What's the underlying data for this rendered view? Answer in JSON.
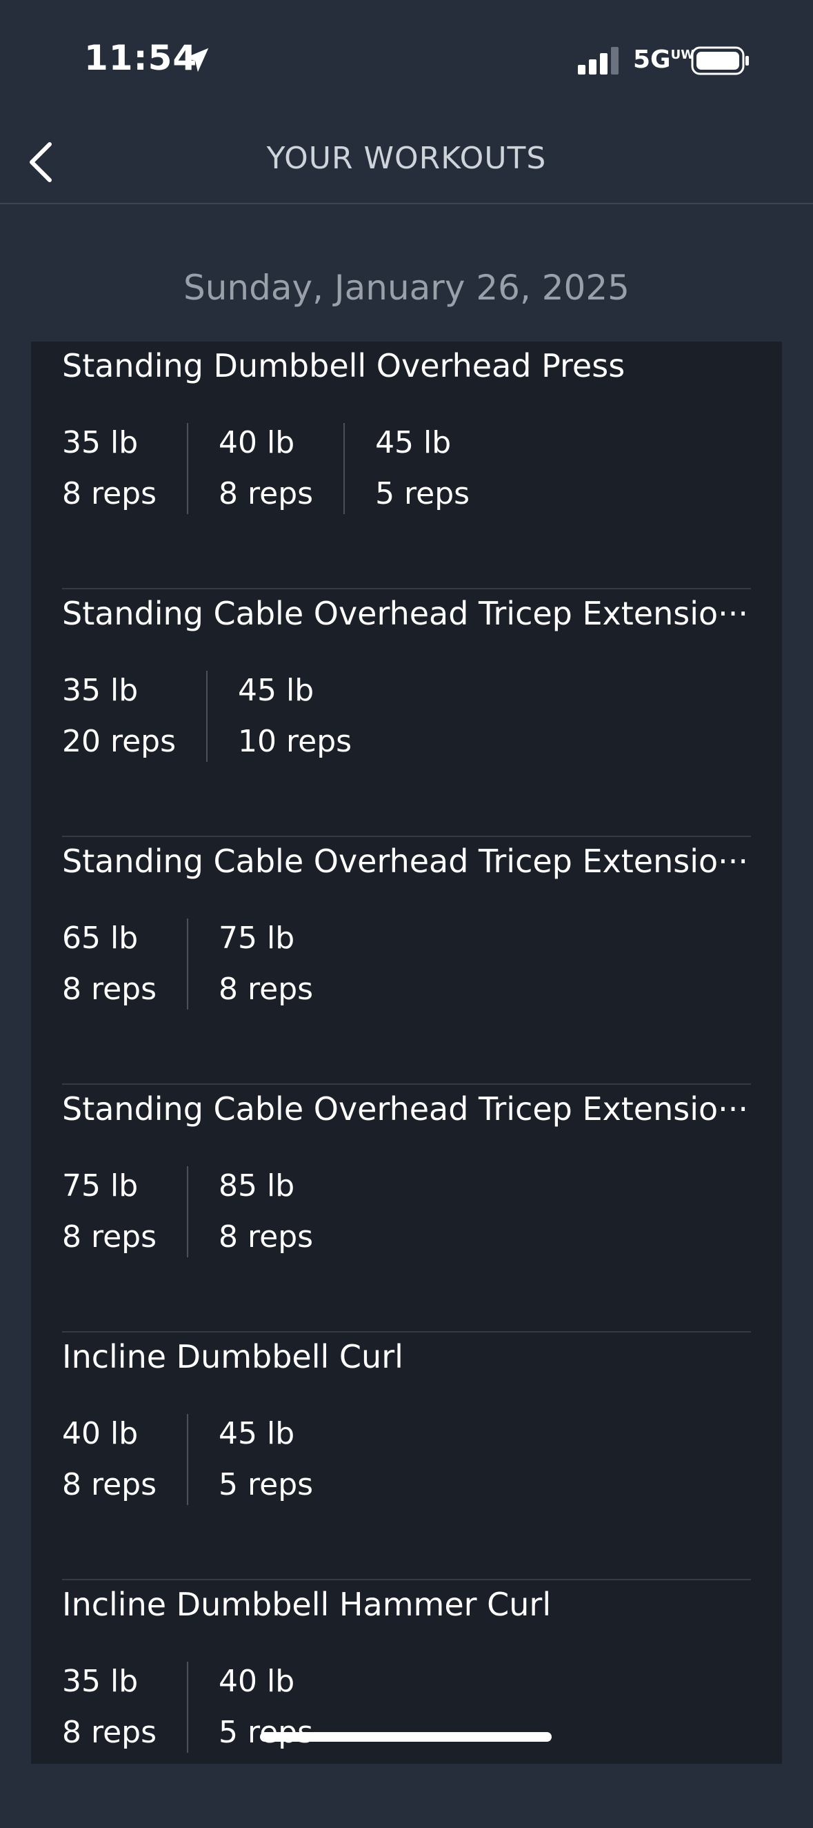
{
  "status_bar": {
    "time": "11:54",
    "network": "5G",
    "network_suffix": "UW",
    "icons": [
      "location-arrow-icon",
      "signal-icon",
      "battery-icon"
    ]
  },
  "header": {
    "title": "YOUR WORKOUTS",
    "back_icon": "chevron-left-icon"
  },
  "date": "Sunday, January 26, 2025",
  "colors": {
    "background": "#262e3b",
    "card": "#1a1f28",
    "text": "#ffffff",
    "muted_text": "#9aa0a9"
  },
  "exercises": [
    {
      "name": "Standing Dumbbell Overhead Press",
      "sets": [
        {
          "weight": "35 lb",
          "reps": "8 reps"
        },
        {
          "weight": "40 lb",
          "reps": "8 reps"
        },
        {
          "weight": "45 lb",
          "reps": "5 reps"
        }
      ]
    },
    {
      "name": "Standing Cable Overhead Tricep Extensio···",
      "sets": [
        {
          "weight": "35 lb",
          "reps": "20 reps"
        },
        {
          "weight": "45 lb",
          "reps": "10 reps"
        }
      ]
    },
    {
      "name": "Standing Cable Overhead Tricep Extensio···",
      "sets": [
        {
          "weight": "65 lb",
          "reps": "8 reps"
        },
        {
          "weight": "75 lb",
          "reps": "8 reps"
        }
      ]
    },
    {
      "name": "Standing Cable Overhead Tricep Extensio···",
      "sets": [
        {
          "weight": "75 lb",
          "reps": "8 reps"
        },
        {
          "weight": "85 lb",
          "reps": "8 reps"
        }
      ]
    },
    {
      "name": "Incline Dumbbell Curl",
      "sets": [
        {
          "weight": "40 lb",
          "reps": "8 reps"
        },
        {
          "weight": "45 lb",
          "reps": "5 reps"
        }
      ]
    },
    {
      "name": "Incline Dumbbell Hammer Curl",
      "sets": [
        {
          "weight": "35 lb",
          "reps": "8 reps"
        },
        {
          "weight": "40 lb",
          "reps": "5 reps"
        }
      ]
    }
  ]
}
